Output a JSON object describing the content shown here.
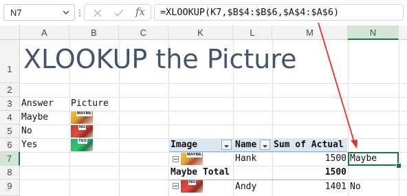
{
  "name_box": "N7",
  "formula": "=XLOOKUP(K7,$B$4:$B$6,$A$4:$A$6)",
  "columns": [
    "A",
    "B",
    "C",
    "K",
    "L",
    "M",
    "N"
  ],
  "rows": [
    "1",
    "2",
    "3",
    "4",
    "5",
    "6",
    "7",
    "8",
    "9"
  ],
  "title": "XLOOKUP the Picture",
  "table": {
    "header_answer": "Answer",
    "header_picture": "Picture",
    "answers": [
      "Maybe",
      "No",
      "Yes"
    ],
    "picture_labels": [
      "MAYBE",
      "NO",
      "YES"
    ]
  },
  "pivot": {
    "col_image": "Image",
    "col_name": "Name",
    "col_sum": "Sum of Actual",
    "row1_name": "Hank",
    "row1_value": "1500",
    "row1_result": "Maybe",
    "total_label": "Maybe Total",
    "total_value": "1500",
    "row2_name": "Andy",
    "row2_value": "1401",
    "row2_result": "No"
  },
  "colors": {
    "selection": "#1e7145",
    "arrow": "#e03030",
    "title": "#44546a",
    "pivot_header": "#dce6f1"
  }
}
